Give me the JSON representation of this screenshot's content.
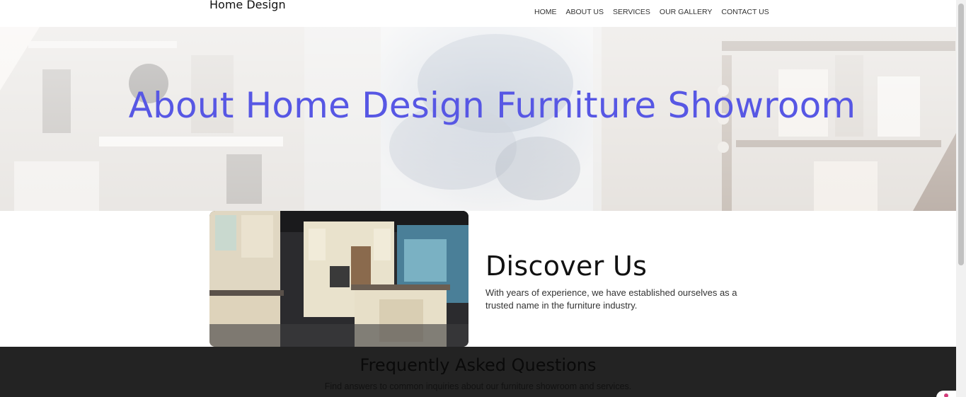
{
  "header": {
    "brand": "Home Design",
    "nav": [
      "HOME",
      "ABOUT US",
      "SERVICES",
      "OUR GALLERY",
      "CONTACT US"
    ]
  },
  "hero": {
    "title": "About Home Design Furniture Showroom"
  },
  "discover": {
    "title": "Discover Us",
    "text": "With years of experience, we have established ourselves as a trusted name in the furniture industry."
  },
  "faq": {
    "title": "Frequently Asked Questions",
    "subtitle": "Find answers to common inquiries about our furniture showroom and services."
  },
  "colors": {
    "accent": "#5757e4",
    "faq_bg": "#232323"
  }
}
